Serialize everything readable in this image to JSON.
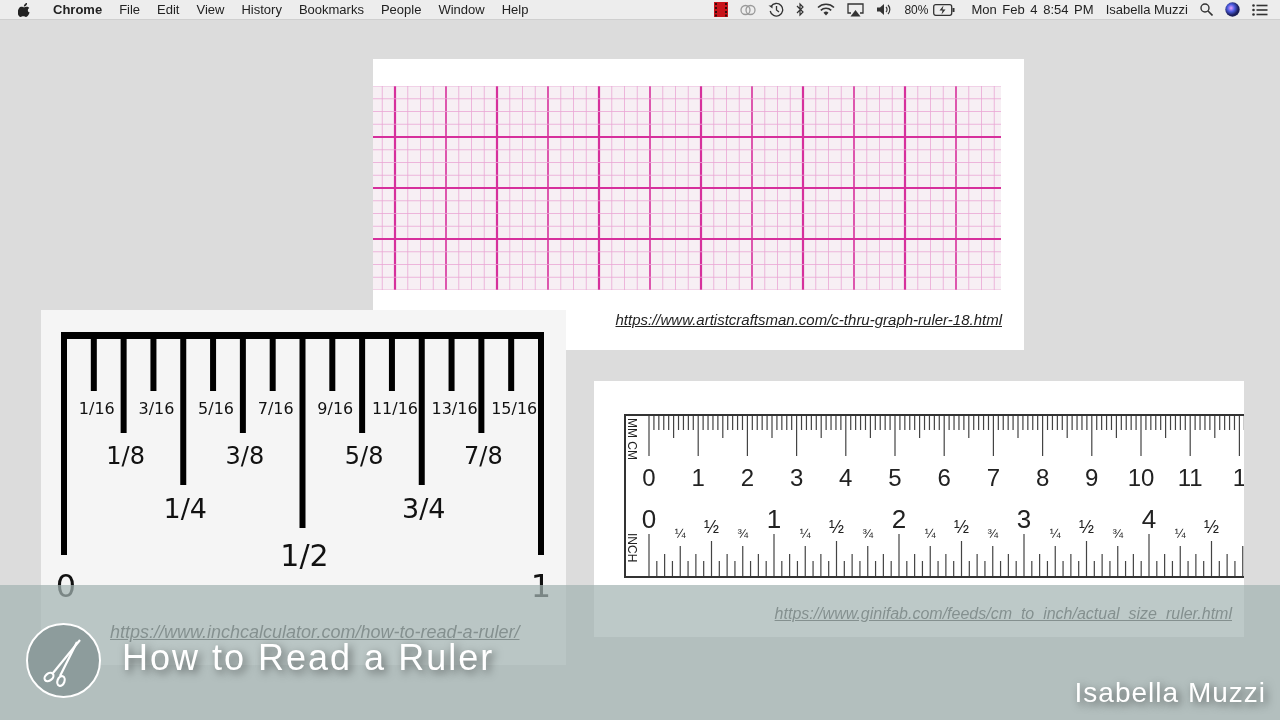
{
  "menu_bar": {
    "app": "Chrome",
    "menus": [
      "File",
      "Edit",
      "View",
      "History",
      "Bookmarks",
      "People",
      "Window",
      "Help"
    ],
    "battery": "80%",
    "clock": "Mon Feb 4 8:54 PM",
    "user": "Isabella Muzzi"
  },
  "slide": {
    "graph_ruler": {
      "source": "https://www.artistcraftsman.com/c-thru-graph-ruler-18.html"
    },
    "fraction_ruler": {
      "sixteenths": [
        "1/16",
        "3/16",
        "5/16",
        "7/16",
        "9/16",
        "11/16",
        "13/16",
        "15/16"
      ],
      "eighths": [
        "1/8",
        "3/8",
        "5/8",
        "7/8"
      ],
      "quarters": [
        "1/4",
        "3/4"
      ],
      "half": "1/2",
      "ends": [
        "0",
        "1"
      ],
      "source": "https://www.inchcalculator.com/how-to-read-a-ruler/"
    },
    "metric_ruler": {
      "cm_label": "MM CM",
      "inch_label": "INCH",
      "cm": [
        "0",
        "1",
        "2",
        "3",
        "4",
        "5",
        "6",
        "7",
        "8",
        "9",
        "10",
        "11",
        "1"
      ],
      "inches": [
        {
          "label": "0",
          "fractions": [
            "¼",
            "½",
            "¾"
          ]
        },
        {
          "label": "1",
          "fractions": [
            "¼",
            "½",
            "¾"
          ]
        },
        {
          "label": "2",
          "fractions": [
            "¼",
            "½",
            "¾"
          ]
        },
        {
          "label": "3",
          "fractions": [
            "¼",
            "½",
            "¾"
          ]
        },
        {
          "label": "4",
          "fractions": [
            "¼",
            "½"
          ]
        }
      ],
      "source": "https://www.ginifab.com/feeds/cm_to_inch/actual_size_ruler.html"
    }
  },
  "lower_third": {
    "title": "How to Read a Ruler",
    "author": "Isabella Muzzi"
  }
}
